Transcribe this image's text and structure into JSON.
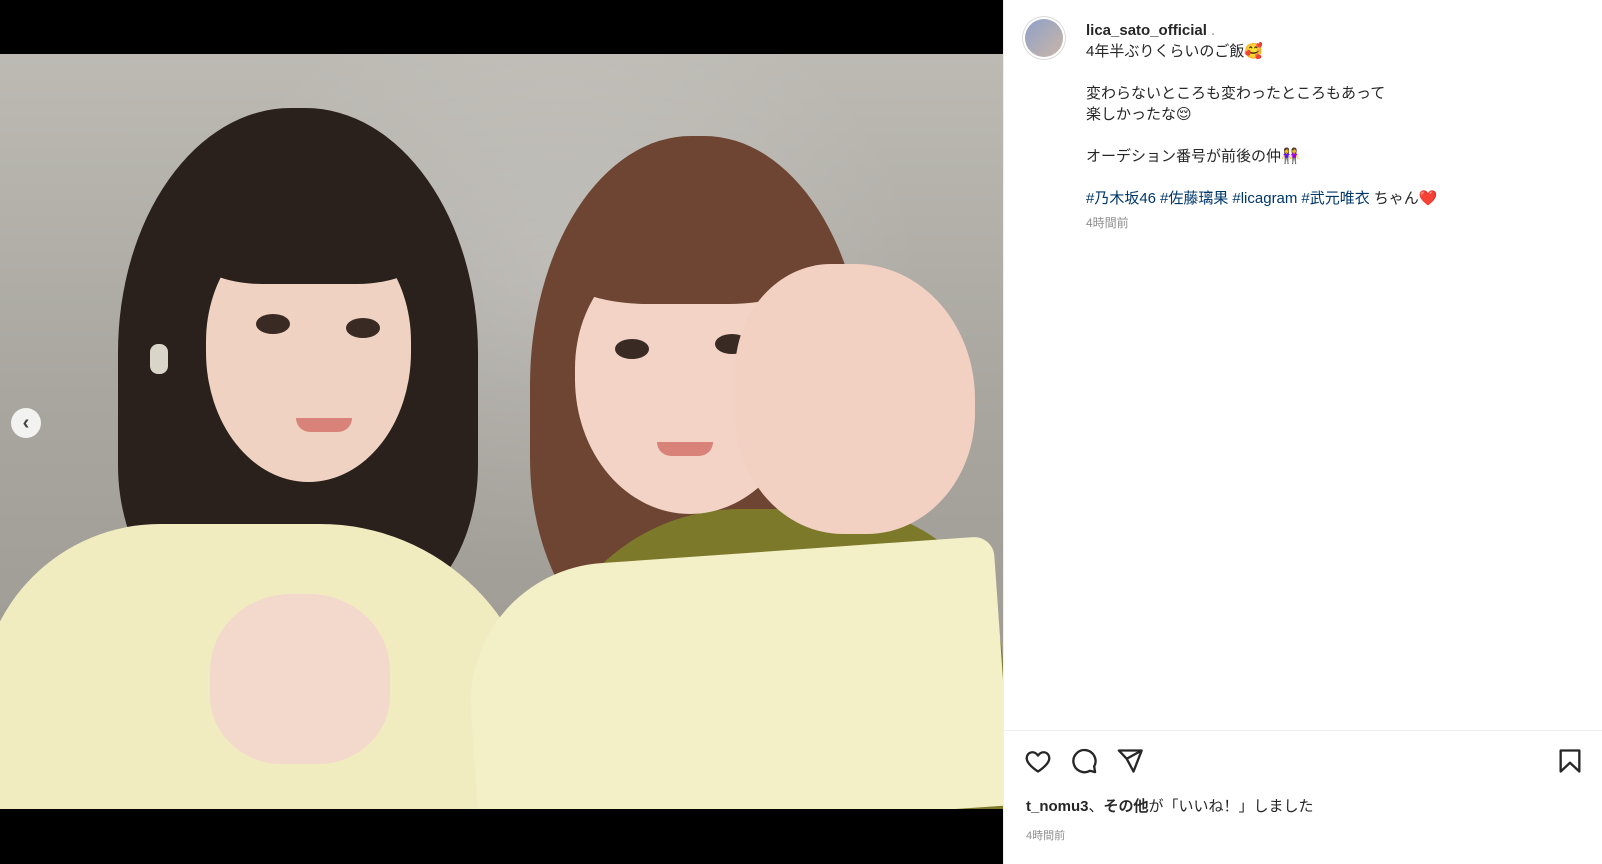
{
  "media": {
    "prev_icon": "chevron-left-icon",
    "carousel_count": 2,
    "carousel_active": 2
  },
  "post": {
    "username": "lica_sato_official",
    "separator": ".",
    "caption_line1": "4年半ぶりくらいのご飯🥰",
    "caption_line2": "変わらないところも変わったところもあって",
    "caption_line3": "楽しかったな😌",
    "caption_line4": "オーデション番号が前後の仲👭",
    "tags": [
      "#乃木坂46",
      "#佐藤璃果",
      "#licagram",
      "#武元唯衣"
    ],
    "tag_suffix": "ちゃん❤️",
    "caption_time": "4時間前"
  },
  "actions": {
    "like_icon": "heart-icon",
    "comment_icon": "comment-icon",
    "share_icon": "send-icon",
    "save_icon": "bookmark-icon"
  },
  "likes": {
    "user": "t_nomu3",
    "sep": "、",
    "others": "その他",
    "suffix": "が「いいね！」しました"
  },
  "post_time": "4時間前"
}
